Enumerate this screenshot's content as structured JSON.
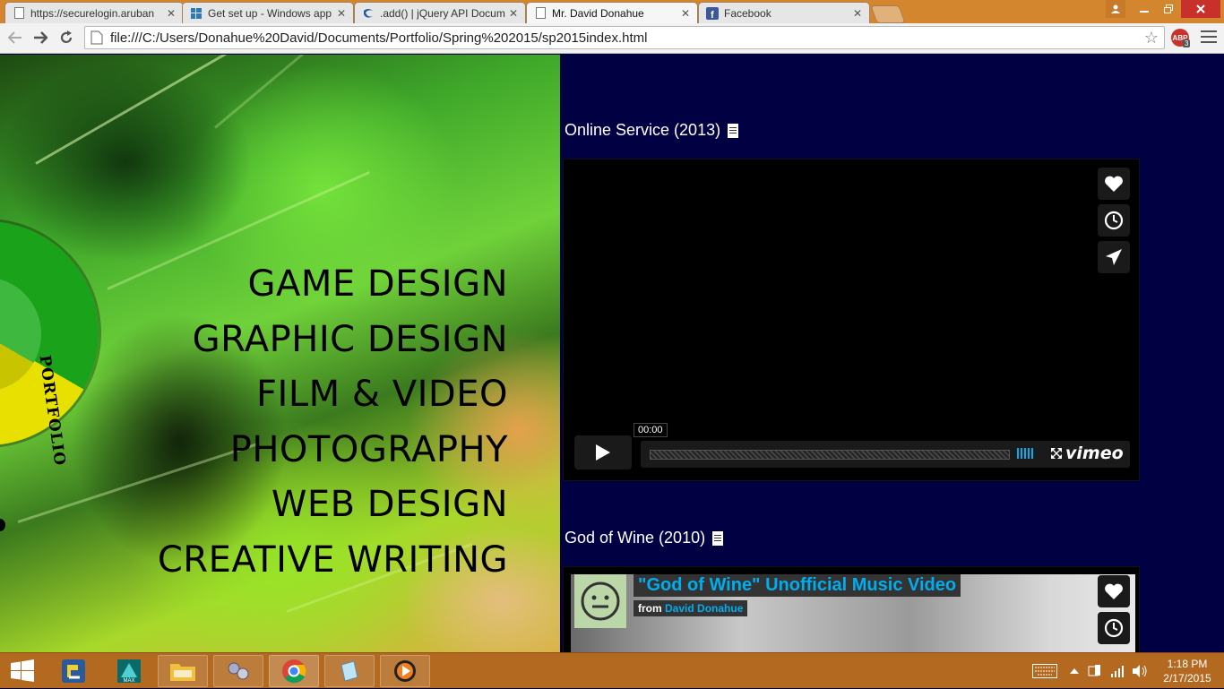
{
  "browser": {
    "tabs": [
      {
        "label": "https://securelogin.aruban",
        "icon": "page-icon"
      },
      {
        "label": "Get set up - Windows app",
        "icon": "windows-icon"
      },
      {
        "label": ".add() | jQuery API Docum",
        "icon": "jquery-icon"
      },
      {
        "label": "Mr. David Donahue",
        "icon": "page-icon",
        "active": true
      },
      {
        "label": "Facebook",
        "icon": "facebook-icon"
      }
    ],
    "url": "file:///C:/Users/Donahue%20David/Documents/Portfolio/Spring%202015/sp2015index.html",
    "abp_label": "ABP",
    "abp_count": "3"
  },
  "page": {
    "wheel_label": "PORTFOLIO",
    "menu_items": [
      "GAME DESIGN",
      "GRAPHIC DESIGN",
      "FILM & VIDEO",
      "PHOTOGRAPHY",
      "WEB DESIGN",
      "CREATIVE WRITING"
    ],
    "videos": [
      {
        "title": "Online Service (2013)",
        "timecode": "00:00",
        "brand": "vimeo"
      },
      {
        "title": "God of Wine (2010)",
        "embed_title": "\"God of Wine\" Unofficial Music Video",
        "from_label": "from",
        "author": "David Donahue"
      }
    ]
  },
  "taskbar": {
    "clock_time": "1:18 PM",
    "clock_date": "2/17/2015"
  },
  "colors": {
    "tabstrip": "#d4862e",
    "content_bg": "#000042",
    "vimeo_blue": "#00adef",
    "taskbar": "#b36a20"
  }
}
